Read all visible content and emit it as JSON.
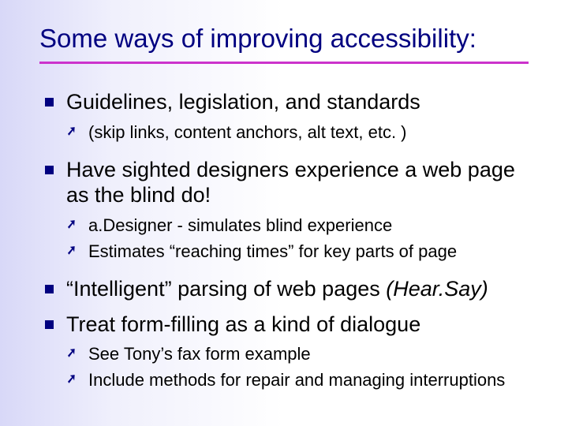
{
  "title": "Some ways of improving accessibility:",
  "bullets": [
    {
      "text_parts": [
        {
          "text": "Guidelines, legislation, and standards",
          "italic": false
        }
      ],
      "subs": [
        "(skip links, content anchors, alt text, etc. )"
      ]
    },
    {
      "text_parts": [
        {
          "text": "Have sighted designers experience a web page as the blind do!",
          "italic": false
        }
      ],
      "subs": [
        "a.Designer - simulates blind experience",
        "Estimates “reaching times” for key parts of page"
      ]
    },
    {
      "text_parts": [
        {
          "text": "“Intelligent” parsing of web pages ",
          "italic": false
        },
        {
          "text": "(Hear.Say)",
          "italic": true
        }
      ],
      "subs": []
    },
    {
      "text_parts": [
        {
          "text": "Treat form-filling as a kind of dialogue",
          "italic": false
        }
      ],
      "subs": [
        "See Tony’s fax form example",
        "Include methods for repair and managing interruptions"
      ]
    }
  ]
}
